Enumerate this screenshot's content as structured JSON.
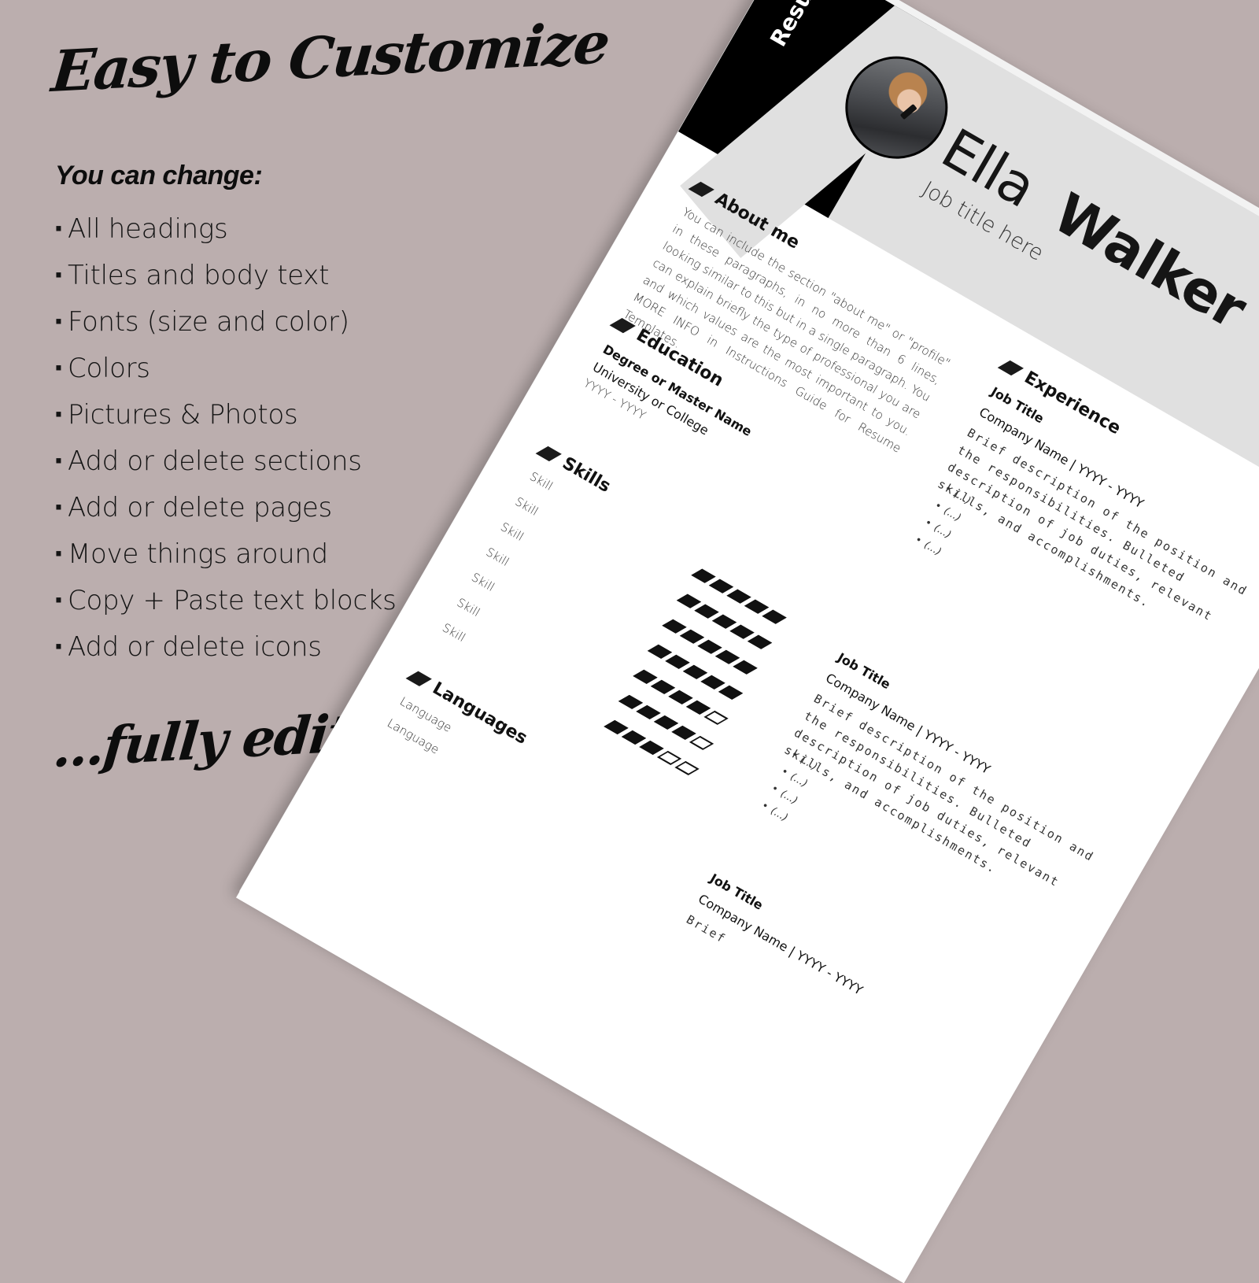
{
  "promo": {
    "title": "Easy to Customize",
    "subtitle": "You can change:",
    "bullet_glyph": "·",
    "features": [
      "All headings",
      "Titles and body text",
      "Fonts (size and color)",
      "Colors",
      "Pictures & Photos",
      "Add or delete sections",
      "Add or delete pages",
      "Move things around",
      "Copy + Paste text blocks",
      "Add or delete icons"
    ],
    "footer": "...fully editable!"
  },
  "colors": {
    "background": "#bbaeae",
    "page": "#ffffff",
    "header_band": "#e0e0e0",
    "accent_black": "#000000"
  },
  "resume": {
    "vertical_label": "Resume",
    "photo_icon": "profile-photo",
    "name": {
      "first": "Ella",
      "last": "Walker"
    },
    "job_title": "Job title here",
    "about": {
      "heading": "About me",
      "text": "You can include the section \"about me\" or \"profile\" in these paragraphs, in no more than 6 lines, looking similar to this but in a single paragraph. You can explain briefly the type of professional you are and which values are the most important to you. MORE INFO in Instructions Guide for Resume Templates."
    },
    "education": {
      "heading": "Education",
      "degree": "Degree or Master Name",
      "school": "University or College",
      "years": "YYYY - YYYY"
    },
    "experience": {
      "heading": "Experience",
      "entries": [
        {
          "title": "Job Title",
          "company": "Company Name | YYYY - YYYY",
          "description": "Brief description of the position and the responsibilities. Bulleted description of job duties, relevant skills, and accomplishments.",
          "bullets": [
            "(...)",
            "(...)",
            "(...)",
            "(...)"
          ]
        },
        {
          "title": "Job Title",
          "company": "Company Name | YYYY - YYYY",
          "description": "Brief description of the position and the responsibilities. Bulleted description of job duties, relevant skills, and accomplishments.",
          "bullets": [
            "(...)",
            "(...)",
            "(...)",
            "(...)"
          ]
        },
        {
          "title": "Job Title",
          "company": "Company Name | YYYY - YYYY",
          "description": "Brief"
        }
      ]
    },
    "skills": {
      "heading": "Skills",
      "items": [
        {
          "label": "Skill",
          "rating": 5,
          "max": 5
        },
        {
          "label": "Skill",
          "rating": 5,
          "max": 5
        },
        {
          "label": "Skill",
          "rating": 5,
          "max": 5
        },
        {
          "label": "Skill",
          "rating": 5,
          "max": 5
        },
        {
          "label": "Skill",
          "rating": 4,
          "max": 5
        },
        {
          "label": "Skill",
          "rating": 4,
          "max": 5
        },
        {
          "label": "Skill",
          "rating": 3,
          "max": 5
        }
      ]
    },
    "languages": {
      "heading": "Languages",
      "items": [
        "Language",
        "Language"
      ]
    }
  }
}
